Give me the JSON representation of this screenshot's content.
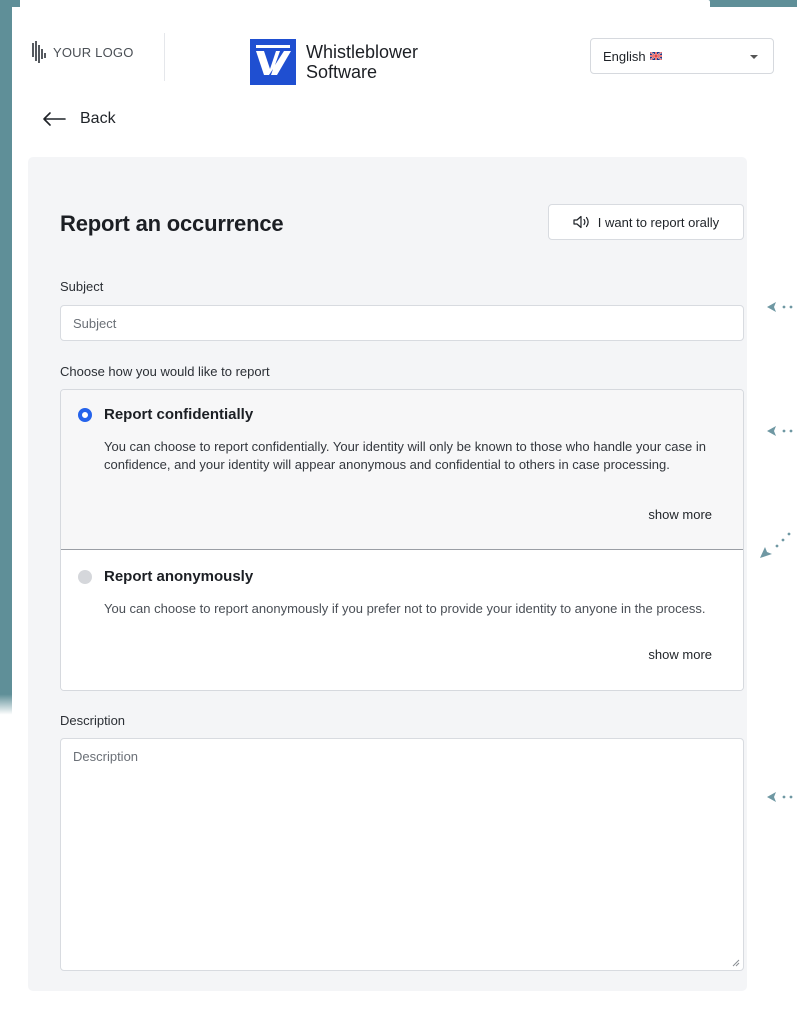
{
  "header": {
    "your_logo": "YOUR LOGO",
    "brand_line1": "Whistleblower",
    "brand_line2": "Software",
    "language": "English"
  },
  "nav": {
    "back_label": "Back"
  },
  "form": {
    "title": "Report an occurrence",
    "oral_button": "I want to report orally",
    "subject_label": "Subject",
    "subject_placeholder": "Subject",
    "choose_label": "Choose how you would like to report",
    "options": [
      {
        "title": "Report confidentially",
        "description": "You can choose to report confidentially. Your identity will only be known to those who handle your case in confidence, and your identity will appear anonymous and confidential to others in case processing.",
        "show_more": "show more",
        "selected": true
      },
      {
        "title": "Report anonymously",
        "description": "You can choose to report anonymously if you prefer not to provide your identity to anyone in the process.",
        "show_more": "show more",
        "selected": false
      }
    ],
    "description_label": "Description",
    "description_placeholder": "Description"
  },
  "colors": {
    "accent": "#2563eb",
    "brand_blue": "#1f4fd1",
    "frame_teal": "#5f8f98",
    "card_bg": "#f4f5f7"
  },
  "icons": [
    "logo-bars-icon",
    "brand-w-icon",
    "uk-flag-icon",
    "chevron-down-icon",
    "arrow-left-icon",
    "speaker-icon",
    "resize-grip-icon",
    "pointer-arrow-icon"
  ]
}
